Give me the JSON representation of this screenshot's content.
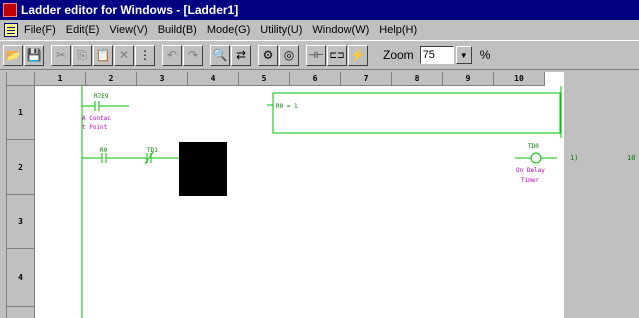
{
  "window": {
    "title": "Ladder editor for Windows - [Ladder1]"
  },
  "menu": {
    "items": [
      {
        "id": "file",
        "label": "File(F)"
      },
      {
        "id": "edit",
        "label": "Edit(E)"
      },
      {
        "id": "view",
        "label": "View(V)"
      },
      {
        "id": "build",
        "label": "Build(B)"
      },
      {
        "id": "mode",
        "label": "Mode(G)"
      },
      {
        "id": "utility",
        "label": "Utility(U)"
      },
      {
        "id": "window",
        "label": "Window(W)"
      },
      {
        "id": "help",
        "label": "Help(H)"
      }
    ]
  },
  "toolbar": {
    "buttons": [
      {
        "name": "open-icon",
        "glyph": "📂",
        "enabled": true
      },
      {
        "name": "save-icon",
        "glyph": "💾",
        "enabled": true
      },
      {
        "name": "cut-icon",
        "glyph": "✂",
        "enabled": false
      },
      {
        "name": "copy-icon",
        "glyph": "⎘",
        "enabled": false
      },
      {
        "name": "paste-icon",
        "glyph": "📋",
        "enabled": false
      },
      {
        "name": "delete-icon",
        "glyph": "✕",
        "enabled": false
      },
      {
        "name": "insert-line-icon",
        "glyph": "⋮",
        "enabled": true
      },
      {
        "name": "undo-icon",
        "glyph": "↶",
        "enabled": false
      },
      {
        "name": "redo-icon",
        "glyph": "↷",
        "enabled": false
      },
      {
        "name": "find-icon",
        "glyph": "🔍",
        "enabled": true
      },
      {
        "name": "replace-icon",
        "glyph": "⇄",
        "enabled": true
      },
      {
        "name": "build-icon",
        "glyph": "⚙",
        "enabled": true
      },
      {
        "name": "monitor-icon",
        "glyph": "◎",
        "enabled": true
      },
      {
        "name": "contact-icon",
        "glyph": "⊣⊢",
        "enabled": true
      },
      {
        "name": "coil-icon",
        "glyph": "⊏⊐",
        "enabled": true
      },
      {
        "name": "online-icon",
        "glyph": "⚡",
        "enabled": true
      }
    ],
    "zoom_label": "Zoom",
    "zoom_value": "75",
    "zoom_unit": "%"
  },
  "grid": {
    "columns": [
      "1",
      "2",
      "3",
      "4",
      "5",
      "6",
      "7",
      "8",
      "9",
      "10"
    ],
    "rows": [
      "1",
      "2",
      "3",
      "4"
    ]
  },
  "ladder": {
    "r1_contact_addr": "R7E9",
    "r1_comment_1": "A Contac",
    "r1_comment_2": "t Point",
    "r1_expression": "R0 = 1",
    "r2_contact1_addr": "R0",
    "r2_contact2_addr": "TD1",
    "r2_timer_addr": "TD0",
    "r2_timer_comment_1": "On Delay",
    "r2_timer_comment_2": "Timer",
    "r2_right_value_1": "1)",
    "r2_right_value_2": "10"
  },
  "colors": {
    "title_bg": "#000080",
    "ladder_green": "#00c000",
    "ladder_text": "#008000",
    "comment_magenta": "#c000c0",
    "cursor_black": "#000000"
  }
}
